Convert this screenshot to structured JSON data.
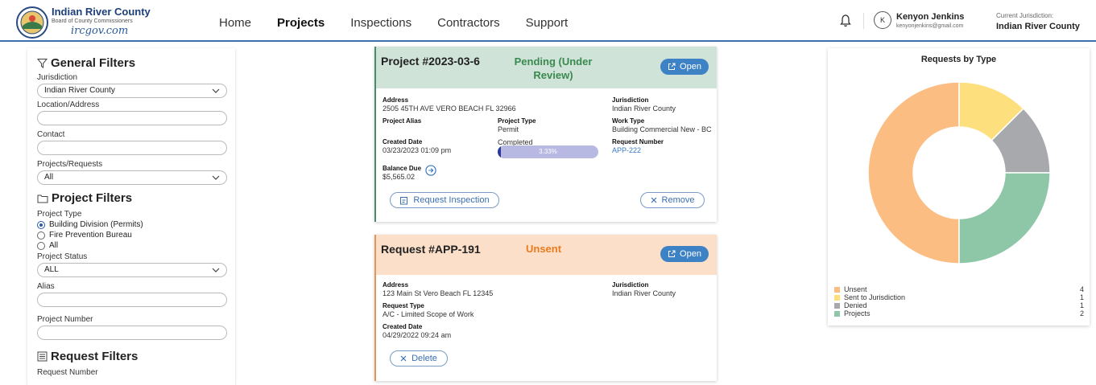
{
  "header": {
    "logo_name": "Indian River County",
    "logo_sub": "Board of County Commissioners",
    "logo_url": "ircgov.com",
    "nav": [
      "Home",
      "Projects",
      "Inspections",
      "Contractors",
      "Support"
    ],
    "active_nav": "Projects",
    "user_initial": "K",
    "user_name": "Kenyon Jenkins",
    "user_email": "kenyonjenkins@gmail.com",
    "jurisdiction_label": "Current Jurisdiction:",
    "jurisdiction_value": "Indian River County"
  },
  "filters": {
    "general_title": "General Filters",
    "jurisdiction_label": "Jurisdiction",
    "jurisdiction_value": "Indian River County",
    "location_label": "Location/Address",
    "contact_label": "Contact",
    "projects_requests_label": "Projects/Requests",
    "projects_requests_value": "All",
    "project_title": "Project Filters",
    "project_type_label": "Project Type",
    "project_types": [
      "Building Division (Permits)",
      "Fire Prevention Bureau",
      "All"
    ],
    "project_type_selected": 0,
    "project_status_label": "Project Status",
    "project_status_value": "ALL",
    "alias_label": "Alias",
    "project_number_label": "Project Number",
    "request_title": "Request Filters",
    "request_number_label": "Request Number"
  },
  "project_card": {
    "title": "Project  #2023-03-6",
    "status_line1": "Pending (Under",
    "status_line2": "Review)",
    "open_label": "Open",
    "address_label": "Address",
    "address": "2505 45TH AVE VERO BEACH FL 32966",
    "jurisdiction_label": "Jurisdiction",
    "jurisdiction": "Indian River County",
    "alias_label": "Project Alias",
    "type_label": "Project Type",
    "type": "Permit",
    "work_type_label": "Work Type",
    "work_type": "Building Commercial New - BC",
    "created_label": "Created Date",
    "created": "03/23/2023 01:09 pm",
    "completed_label": "Completed",
    "completed_pct": 3.33,
    "completed_text": "3.33%",
    "request_number_label": "Request Number",
    "request_number": "APP-222",
    "balance_label": "Balance Due",
    "balance": "$5,565.02",
    "request_inspection_label": "Request Inspection",
    "remove_label": "Remove"
  },
  "request_card": {
    "title": "Request #APP-191",
    "status": "Unsent",
    "open_label": "Open",
    "address_label": "Address",
    "address": "123 Main St Vero Beach FL 12345",
    "jurisdiction_label": "Jurisdiction",
    "jurisdiction": "Indian River County",
    "request_type_label": "Request Type",
    "request_type": "A/C - Limited Scope of Work",
    "created_label": "Created Date",
    "created": "04/29/2022 09:24 am",
    "delete_label": "Delete"
  },
  "chart_data": {
    "type": "pie",
    "title": "Requests by Type",
    "donut": true,
    "categories": [
      "Unsent",
      "Sent to Jurisdiction",
      "Denied",
      "Projects"
    ],
    "values": [
      4,
      1,
      1,
      2
    ],
    "colors": [
      "#fbbd82",
      "#fde07d",
      "#a8a9ad",
      "#8ec7a7"
    ],
    "legend": "bottom"
  }
}
